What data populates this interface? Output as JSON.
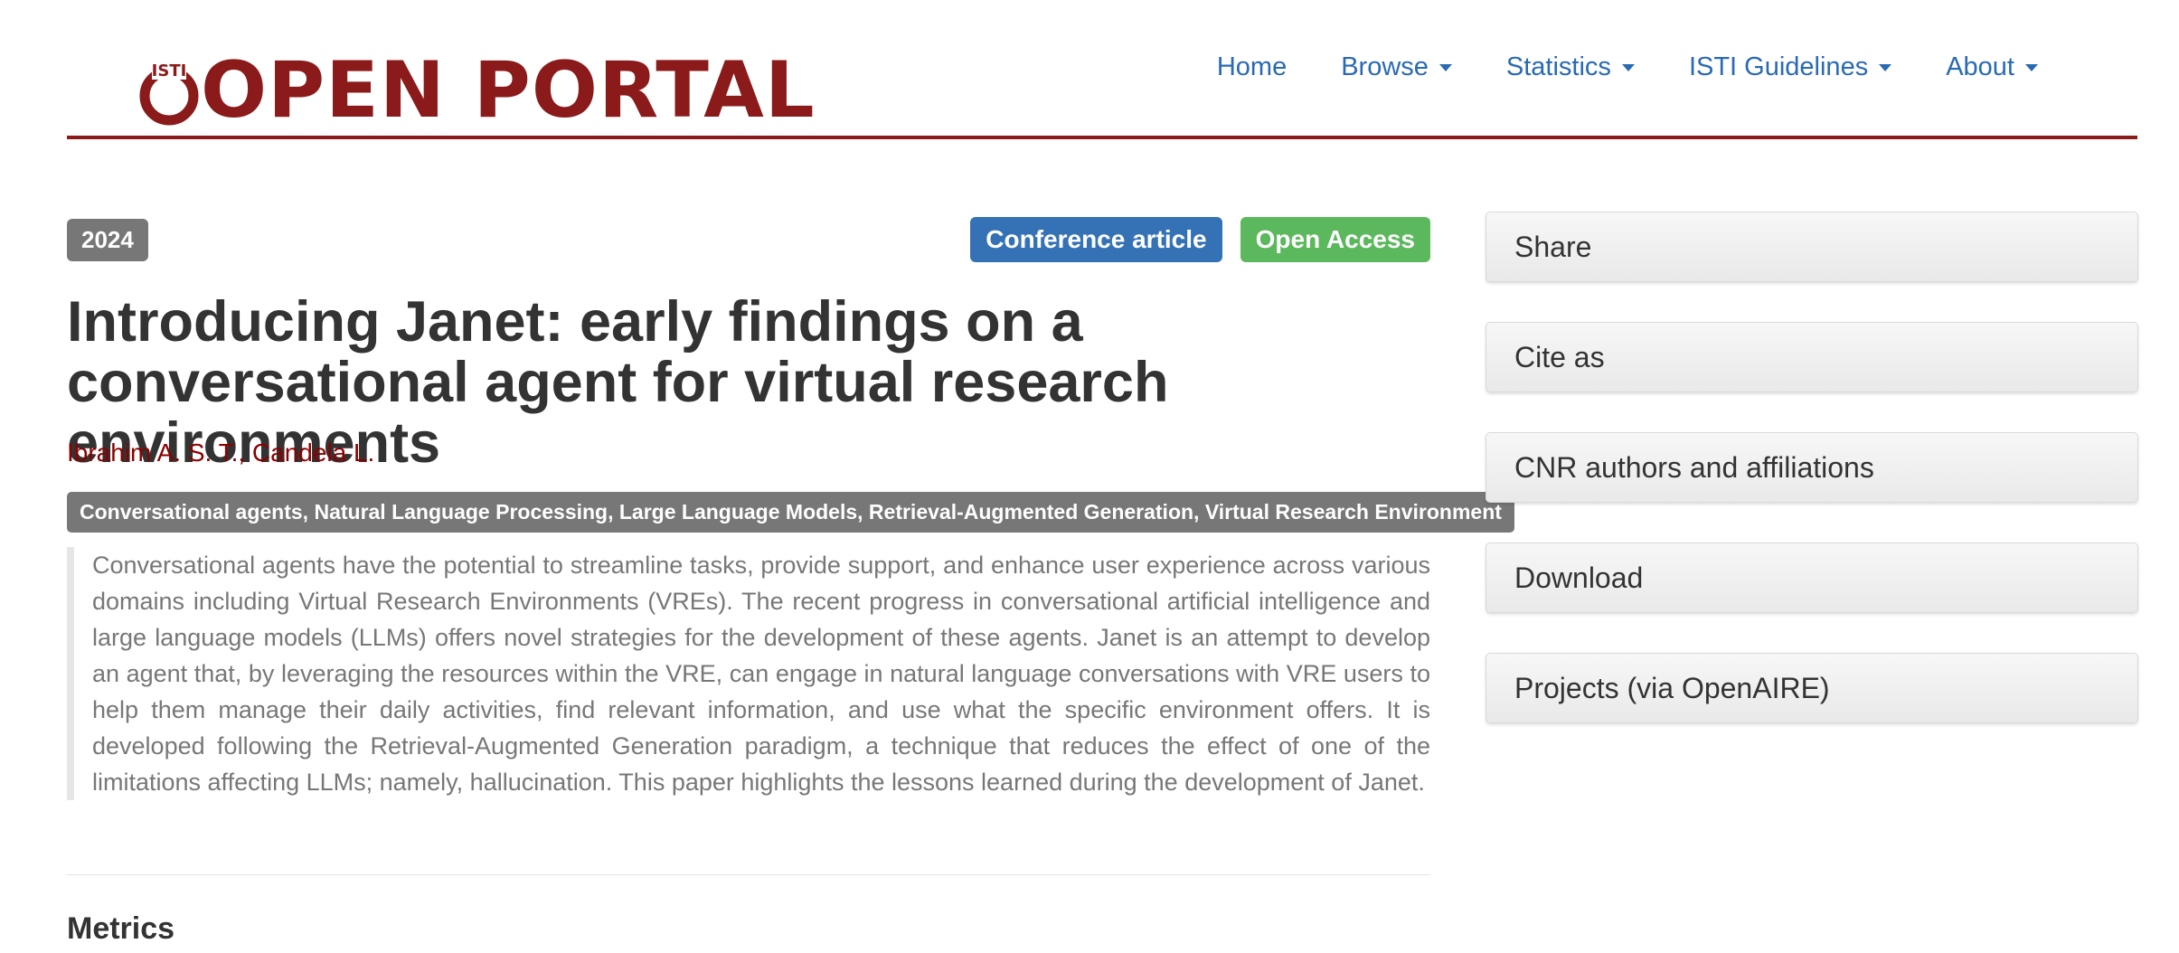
{
  "header": {
    "logo_text": "OPEN PORTAL",
    "logo_mark_text": "ISTI",
    "brand_color": "#8b1a1a",
    "nav": [
      {
        "label": "Home",
        "dropdown": false
      },
      {
        "label": "Browse",
        "dropdown": true
      },
      {
        "label": "Statistics",
        "dropdown": true
      },
      {
        "label": "ISTI Guidelines",
        "dropdown": true
      },
      {
        "label": "About",
        "dropdown": true
      }
    ]
  },
  "article": {
    "year": "2024",
    "type_badge": "Conference article",
    "access_badge": "Open Access",
    "title": "Introducing Janet: early findings on a conversational agent for virtual research environments",
    "authors": "Ibrahim A. S. T., Candela L.",
    "keywords": "Conversational agents, Natural Language Processing, Large Language Models, Retrieval-Augmented Generation, Virtual Research Environment",
    "abstract": "Conversational agents have the potential to streamline tasks, provide support, and enhance user experience across various domains including Virtual Research Environments (VREs). The recent progress in conversational artificial intelligence and large language models (LLMs) offers novel strategies for the development of these agents. Janet is an attempt to develop an agent that, by leveraging the resources within the VRE, can engage in natural language conversations with VRE users to help them manage their daily activities, find relevant information, and use what the specific environment offers. It is developed following the Retrieval-Augmented Generation paradigm, a technique that reduces the effect of one of the limitations affecting LLMs; namely, hallucination. This paper highlights the lessons learned during the development of Janet.",
    "metrics_heading": "Metrics"
  },
  "sidebar": {
    "panels": [
      {
        "label": "Share"
      },
      {
        "label": "Cite as"
      },
      {
        "label": "CNR authors and affiliations"
      },
      {
        "label": "Download"
      },
      {
        "label": "Projects (via OpenAIRE)"
      }
    ]
  },
  "colors": {
    "link": "#2a6ab3",
    "author": "#8b0000",
    "badge_gray": "#777777",
    "badge_blue": "#3572b5",
    "badge_green": "#5cb85c"
  }
}
